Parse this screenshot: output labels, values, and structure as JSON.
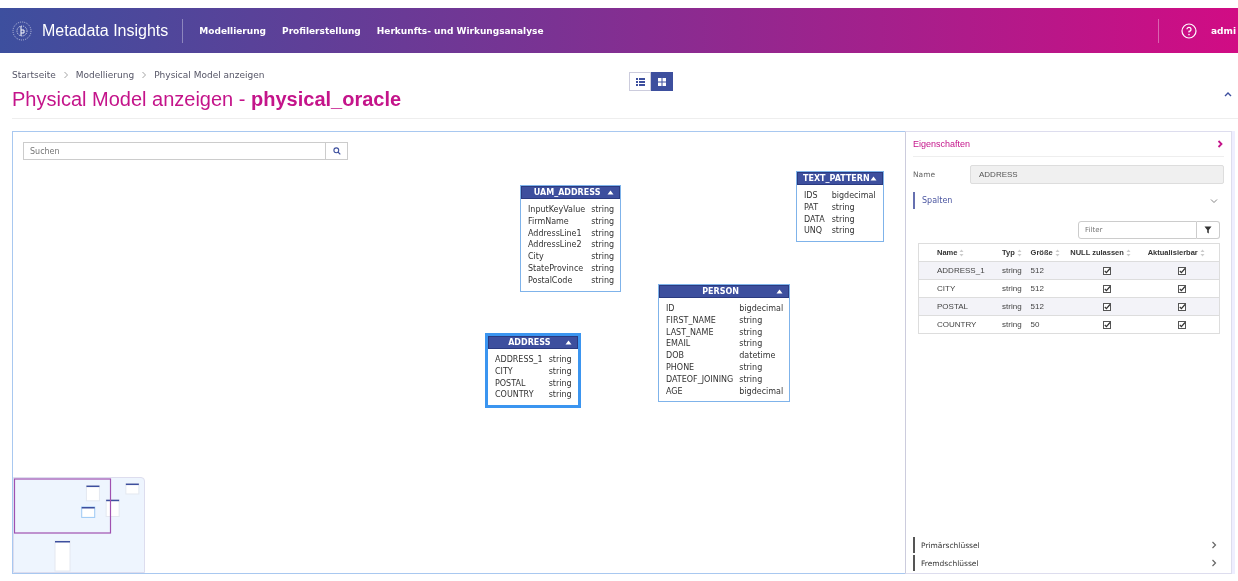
{
  "header": {
    "app_name": "Metadata Insights",
    "nav": [
      {
        "label": "Modellierung"
      },
      {
        "label": "Profilerstellung"
      },
      {
        "label": "Herkunfts- und Wirkungsanalyse"
      }
    ],
    "user": "admi"
  },
  "breadcrumb": [
    {
      "label": "Startseite"
    },
    {
      "label": "Modellierung"
    },
    {
      "label": "Physical Model anzeigen"
    }
  ],
  "page_title": {
    "prefix": "Physical Model anzeigen - ",
    "name": "physical_oracle"
  },
  "view_toggle": [
    {
      "kind": "list",
      "selected": false
    },
    {
      "kind": "grid",
      "selected": true
    }
  ],
  "search": {
    "placeholder": "Suchen"
  },
  "entities": [
    {
      "name": "UAM_ADDRESS",
      "selected": false,
      "columns": [
        [
          "InputKeyValue",
          "string"
        ],
        [
          "FirmName",
          "string"
        ],
        [
          "AddressLine1",
          "string"
        ],
        [
          "AddressLine2",
          "string"
        ],
        [
          "City",
          "string"
        ],
        [
          "StateProvince",
          "string"
        ],
        [
          "PostalCode",
          "string"
        ]
      ]
    },
    {
      "name": "TEXT_PATTERN",
      "selected": false,
      "columns": [
        [
          "IDS",
          "bigdecimal"
        ],
        [
          "PAT",
          "string"
        ],
        [
          "DATA",
          "string"
        ],
        [
          "UNQ",
          "string"
        ]
      ]
    },
    {
      "name": "ADDRESS",
      "selected": true,
      "columns": [
        [
          "ADDRESS_1",
          "string"
        ],
        [
          "CITY",
          "string"
        ],
        [
          "POSTAL",
          "string"
        ],
        [
          "COUNTRY",
          "string"
        ]
      ]
    },
    {
      "name": "PERSON",
      "selected": false,
      "columns": [
        [
          "ID",
          "bigdecimal"
        ],
        [
          "FIRST_NAME",
          "string"
        ],
        [
          "LAST_NAME",
          "string"
        ],
        [
          "EMAIL",
          "string"
        ],
        [
          "DOB",
          "datetime"
        ],
        [
          "PHONE",
          "string"
        ],
        [
          "DATEOF_JOINING",
          "string"
        ],
        [
          "AGE",
          "bigdecimal"
        ]
      ]
    }
  ],
  "properties": {
    "title": "Eigenschaften",
    "name_label": "Name",
    "name_value": "ADDRESS",
    "columns_section": {
      "title": "Spalten",
      "expanded": true,
      "filter_placeholder": "Filter",
      "table": {
        "columns": [
          "Name",
          "Typ",
          "Größe",
          "NULL zulassen",
          "Aktualisierbar"
        ],
        "rows": [
          {
            "name": "ADDRESS_1",
            "type": "string",
            "size": "512",
            "nullable": true,
            "updatable": true
          },
          {
            "name": "CITY",
            "type": "string",
            "size": "512",
            "nullable": true,
            "updatable": true
          },
          {
            "name": "POSTAL",
            "type": "string",
            "size": "512",
            "nullable": true,
            "updatable": true
          },
          {
            "name": "COUNTRY",
            "type": "string",
            "size": "50",
            "nullable": true,
            "updatable": true
          }
        ]
      }
    },
    "sections": [
      {
        "title": "Primärschlüssel",
        "expanded": false
      },
      {
        "title": "Fremdschlüssel",
        "expanded": false
      }
    ]
  }
}
